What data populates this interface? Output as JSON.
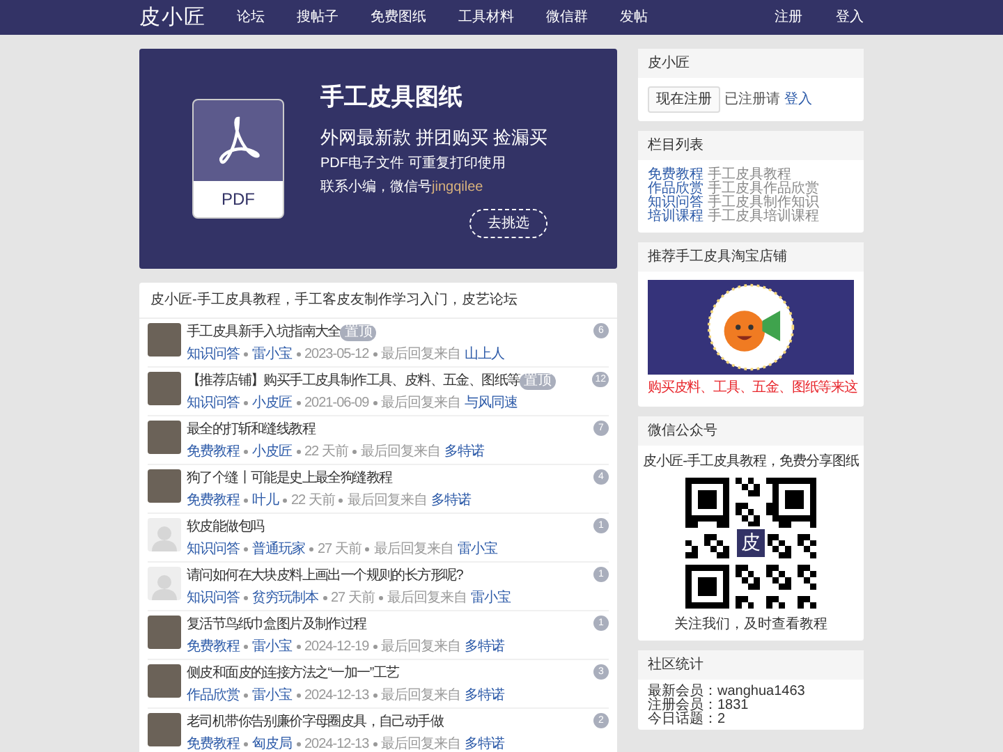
{
  "nav": {
    "logo": "皮小匠",
    "links": [
      "论坛",
      "搜帖子",
      "免费图纸",
      "工具材料",
      "微信群",
      "发帖"
    ],
    "account": [
      "注册",
      "登入"
    ]
  },
  "banner": {
    "title": "手工皮具图纸",
    "subtitle": "外网最新款 拼团购买 捡漏买",
    "line": "PDF电子文件 可重复打印使用",
    "contact": "联系小编，微信号",
    "contact_id": "jingqilee",
    "icon_label": "PDF",
    "button": "去挑选"
  },
  "forum": {
    "heading": "皮小匠-手工皮具教程，手工客皮友制作学习入门，皮艺论坛",
    "topics": [
      {
        "kind": "photo",
        "title": "手工皮具新手入坑指南大全",
        "badge": "置顶",
        "category": "知识问答",
        "author": "雷小宝",
        "time": "2023-05-12",
        "last_label": "最后回复来自",
        "last_user": "山上人",
        "count": "6"
      },
      {
        "kind": "photo",
        "title": "【推荐店铺】购买手工皮具制作工具、皮料、五金、图纸等",
        "badge": "置顶",
        "category": "知识问答",
        "author": "小皮匠",
        "time": "2021-06-09",
        "last_label": "最后回复来自",
        "last_user": "与风同速",
        "count": "12"
      },
      {
        "kind": "photo",
        "title": "最全的打斩和缝线教程",
        "category": "免费教程",
        "author": "小皮匠",
        "time": "22 天前",
        "last_label": "最后回复来自",
        "last_user": "多特诺",
        "count": "7"
      },
      {
        "kind": "photo",
        "title": "狗了个缝丨可能是史上最全狗缝教程",
        "category": "免费教程",
        "author": "叶儿",
        "time": "22 天前",
        "last_label": "最后回复来自",
        "last_user": "多特诺",
        "count": "4"
      },
      {
        "kind": "default",
        "title": "软皮能做包吗",
        "category": "知识问答",
        "author": "普通玩家",
        "time": "27 天前",
        "last_label": "最后回复来自",
        "last_user": "雷小宝",
        "count": "1"
      },
      {
        "kind": "default",
        "title": "请问如何在大块皮料上画出一个规则的长方形呢?",
        "category": "知识问答",
        "author": "贫穷玩制本",
        "time": "27 天前",
        "last_label": "最后回复来自",
        "last_user": "雷小宝",
        "count": "1"
      },
      {
        "kind": "photo",
        "title": "复活节鸟纸巾盒图片及制作过程",
        "category": "免费教程",
        "author": "雷小宝",
        "time": "2024-12-19",
        "last_label": "最后回复来自",
        "last_user": "多特诺",
        "count": "1"
      },
      {
        "kind": "photo",
        "title": "侧皮和面皮的连接方法之“一加一”工艺",
        "category": "作品欣赏",
        "author": "雷小宝",
        "time": "2024-12-13",
        "last_label": "最后回复来自",
        "last_user": "多特诺",
        "count": "3"
      },
      {
        "kind": "photo",
        "title": "老司机带你告别廉价字母圈皮具，自己动手做",
        "category": "免费教程",
        "author": "匈皮局",
        "time": "2024-12-13",
        "last_label": "最后回复来自",
        "last_user": "多特诺",
        "count": "2"
      }
    ]
  },
  "sidebar": {
    "account": {
      "title": "皮小匠",
      "register_button": "现在注册",
      "note": "已注册请",
      "login_link": "登入"
    },
    "categories": {
      "title": "栏目列表",
      "items": [
        {
          "name": "免费教程",
          "desc": "手工皮具教程"
        },
        {
          "name": "作品欣赏",
          "desc": "手工皮具作品欣赏"
        },
        {
          "name": "知识问答",
          "desc": "手工皮具制作知识"
        },
        {
          "name": "培训课程",
          "desc": "手工皮具培训课程"
        }
      ]
    },
    "shop": {
      "title": "推荐手工皮具淘宝店铺",
      "caption": "购买皮料、工具、五金、图纸等来这"
    },
    "wechat": {
      "title": "微信公众号",
      "intro": "皮小匠-手工皮具教程，免费分享图纸",
      "qr_label": "皮",
      "caption": "关注我们，及时查看教程"
    },
    "stats": {
      "title": "社区统计",
      "rows": [
        {
          "label": "最新会员：",
          "value": "wanghua1463"
        },
        {
          "label": "注册会员：",
          "value": "1831"
        },
        {
          "label": "今日话题：",
          "value": "2"
        }
      ]
    }
  }
}
